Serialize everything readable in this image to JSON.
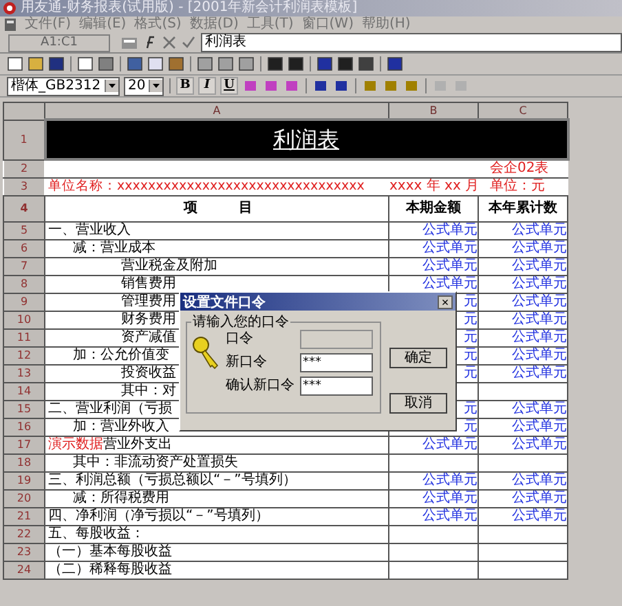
{
  "window": {
    "title": "用友通-财务报表(试用版) - [2001年新会计利润表模板]"
  },
  "menu": [
    "文件(F)",
    "编辑(E)",
    "格式(S)",
    "数据(D)",
    "工具(T)",
    "窗口(W)",
    "帮助(H)"
  ],
  "formula_bar": {
    "cell_ref": "A1:C1",
    "value": "利润表"
  },
  "format_bar": {
    "font": "楷体_GB2312",
    "size": "20",
    "style_buttons": [
      "B",
      "I",
      "U"
    ]
  },
  "sheet": {
    "columns": [
      "A",
      "B",
      "C"
    ],
    "rows": [
      {
        "number": "1",
        "kind": "title",
        "a": "利润表"
      },
      {
        "number": "2",
        "kind": "info",
        "a": "",
        "b": "",
        "c": "会企02表"
      },
      {
        "number": "3",
        "kind": "info",
        "a": "单位名称：xxxxxxxxxxxxxxxxxxxxxxxxxxxxxxxx",
        "b": "xxxx 年 xx 月",
        "c": "单位：元"
      },
      {
        "number": "4",
        "kind": "header",
        "a": "项　　　目",
        "b": "本期金额",
        "c": "本年累计数"
      },
      {
        "number": "5",
        "kind": "section",
        "a": "一、营业收入",
        "b": "公式单元",
        "c": "公式单元"
      },
      {
        "number": "6",
        "kind": "sub",
        "a": "减：营业成本",
        "b": "公式单元",
        "c": "公式单元"
      },
      {
        "number": "7",
        "kind": "detail",
        "a": "营业税金及附加",
        "b": "公式单元",
        "c": "公式单元"
      },
      {
        "number": "8",
        "kind": "detail",
        "a": "销售费用",
        "b": "公式单元",
        "c": "公式单元"
      },
      {
        "number": "9",
        "kind": "detail",
        "a": "管理费用",
        "b": "元",
        "c": "公式单元"
      },
      {
        "number": "10",
        "kind": "detail",
        "a": "财务费用",
        "b": "元",
        "c": "公式单元"
      },
      {
        "number": "11",
        "kind": "detail",
        "a": "资产减值",
        "b": "元",
        "c": "公式单元"
      },
      {
        "number": "12",
        "kind": "sub",
        "a": "加：公允价值变",
        "b": "元",
        "c": "公式单元"
      },
      {
        "number": "13",
        "kind": "detail",
        "a": "投资收益",
        "b": "元",
        "c": "公式单元"
      },
      {
        "number": "14",
        "kind": "detail",
        "a": "其中：对",
        "b": "",
        "c": ""
      },
      {
        "number": "15",
        "kind": "section",
        "a": "二、营业利润（亏损",
        "b": "元",
        "c": "公式单元"
      },
      {
        "number": "16",
        "kind": "sub",
        "a": "加：营业外收入",
        "b": "元",
        "c": "公式单元"
      },
      {
        "number": "17",
        "kind": "section",
        "note": "演示数据",
        "a": "营业外支出",
        "b": "公式单元",
        "c": "公式单元"
      },
      {
        "number": "18",
        "kind": "sub",
        "a": "其中：非流动资产处置损失",
        "b": "",
        "c": ""
      },
      {
        "number": "19",
        "kind": "section",
        "a": "三、利润总额（亏损总额以“－”号填列）",
        "b": "公式单元",
        "c": "公式单元"
      },
      {
        "number": "20",
        "kind": "sub",
        "a": "减：所得税费用",
        "b": "公式单元",
        "c": "公式单元"
      },
      {
        "number": "21",
        "kind": "section",
        "a": "四、净利润（净亏损以“－”号填列）",
        "b": "公式单元",
        "c": "公式单元"
      },
      {
        "number": "22",
        "kind": "section",
        "a": "五、每股收益：",
        "b": "",
        "c": ""
      },
      {
        "number": "23",
        "kind": "section",
        "a": "（一）基本每股收益",
        "b": "",
        "c": ""
      },
      {
        "number": "24",
        "kind": "section",
        "a": "（二）稀释每股收益",
        "b": "",
        "c": ""
      }
    ]
  },
  "dialog": {
    "title": "设置文件口令",
    "close": "×",
    "group": "请输入您的口令",
    "fields": [
      {
        "label": "口令",
        "disabled": true
      },
      {
        "label": "新口令",
        "value": "***",
        "disabled": false
      },
      {
        "label": "确认新口令",
        "value": "***",
        "disabled": false
      }
    ],
    "buttons": [
      "确定",
      "取消"
    ]
  }
}
